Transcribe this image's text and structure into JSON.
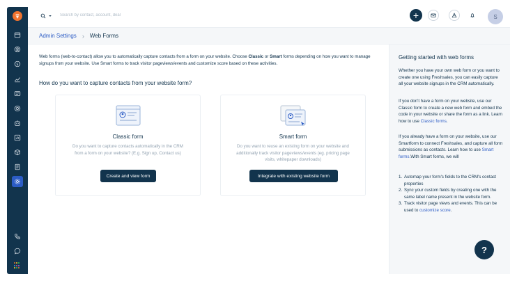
{
  "topbar": {
    "search_placeholder": "Search by contact, account, deal",
    "plus_label": "+",
    "avatar_initial": "S"
  },
  "breadcrumb": {
    "parent": "Admin Settings",
    "separator": "›",
    "current": "Web Forms"
  },
  "main": {
    "intro_part1": "Web forms (web-to-contact) allow you to automatically capture contacts from a form on your website. Choose ",
    "intro_classic": "Classic",
    "intro_or": " or ",
    "intro_smart": "Smart",
    "intro_part2": " forms depending on how you want to manage signups from your website. Use Smart forms to track visitor pageviews/events and customize score based on these activities.",
    "question": "How do you want to capture contacts from your website form?",
    "cards": [
      {
        "title": "Classic form",
        "description": "Do you want to capture contacts automatically in the CRM from a form on your website? (E.g. Sign up, Contact us)",
        "button": "Create and view form"
      },
      {
        "title": "Smart form",
        "description": "Do you want to reuse an existing form on your website and additionally track visitor pageviews/events (eg. pricing page visits, whitepaper downloads)",
        "button": "Integrate with existing website form"
      }
    ]
  },
  "panel": {
    "title": "Getting started with web forms",
    "p1": "Whether you have your own web form or you want to create one using Freshsales, you can easily capture all your website signups in the CRM automatically.",
    "p2_text": "If you don't have a form on your website, use our Classic form to create a new web form and embed the code in your website or share the form as a link. Learn how to use ",
    "p2_link": "Classic forms",
    "p2_end": ".",
    "p3_text": "If you already have a form on your website, use our Smartform to connect Freshsales, and capture all form submissions as contacts. Learn how to use ",
    "p3_link": "Smart forms",
    "p3_end": ".With Smart forms, we will",
    "list": [
      {
        "num": "1.",
        "text": "Automap your form's fields to the CRM's contact properties"
      },
      {
        "num": "2.",
        "text": "Sync your custom fields by creating one with the same label name present in the website form."
      },
      {
        "num": "3.",
        "text": "Track visitor page views and events. This can be used to "
      }
    ],
    "list3_link": "customize score",
    "list3_end": "."
  },
  "help_label": "?",
  "colors": {
    "sidebar": "#12344d",
    "accent": "#2c5cc5",
    "logo": "#f0732e",
    "primary_button": "#12344d"
  },
  "icons": {
    "sidebar": [
      "calendar-icon",
      "contacts-icon",
      "deals-icon",
      "reports-icon",
      "chat-icon",
      "target-icon",
      "bot-icon",
      "analytics-icon",
      "products-icon",
      "documents-icon",
      "settings-icon",
      "phone-icon",
      "message-icon"
    ]
  }
}
